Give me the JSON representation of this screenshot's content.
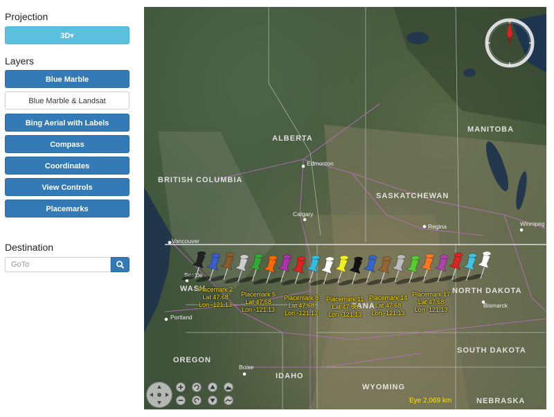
{
  "sidebar": {
    "projection_heading": "Projection",
    "projection_button": "3D▾",
    "layers_heading": "Layers",
    "layers": [
      {
        "label": "Blue Marble",
        "active": true
      },
      {
        "label": "Blue Marble & Landsat",
        "active": false
      },
      {
        "label": "Bing Aerial with Labels",
        "active": true
      },
      {
        "label": "Compass",
        "active": true
      },
      {
        "label": "Coordinates",
        "active": true
      },
      {
        "label": "View Controls",
        "active": true
      },
      {
        "label": "Placemarks",
        "active": true
      }
    ],
    "destination_heading": "Destination",
    "goto_placeholder": "GoTo"
  },
  "map": {
    "region_labels": [
      "ALBERTA",
      "BRITISH COLUMBIA",
      "SASKATCHEWAN",
      "MANITOBA",
      "NORTH DAKOTA",
      "SOUTH DAKOTA",
      "OREGON",
      "IDAHO",
      "WYOMING",
      "NEBRASKA",
      "WASH",
      "TANA"
    ],
    "city_labels": [
      "Edmonton",
      "Calgary",
      "Regina",
      "Winnipeg",
      "Vancouver",
      "Seattle",
      "Portland",
      "Boise",
      "Bismarck"
    ],
    "placemarks": [
      {
        "name": "Placemark 2",
        "lat": "Lat 47.68",
        "lon": "Lon -121.13"
      },
      {
        "name": "Placemark 5",
        "lat": "Lat 47.68",
        "lon": "Lon -121.13"
      },
      {
        "name": "Placemark 8",
        "lat": "Lat 47.68",
        "lon": "Lon -121.13"
      },
      {
        "name": "Placemark 11",
        "lat": "Lat 47.68",
        "lon": "Lon -121.13"
      },
      {
        "name": "Placemark 14",
        "lat": "Lat 47.68",
        "lon": "Lon -121.13"
      },
      {
        "name": "Placemark 17",
        "lat": "Lat 47.68",
        "lon": "Lon -121.13"
      }
    ],
    "pin_colors": [
      "#222222",
      "#3a5fcd",
      "#8b5a2b",
      "#cccccc",
      "#33aa33",
      "#ff6a00",
      "#aa33aa",
      "#dd2222",
      "#33bbdd",
      "#ffffff",
      "#eeee22",
      "#111111",
      "#3366cc",
      "#996633",
      "#bbbbbb",
      "#55cc33",
      "#ff7722",
      "#aa44aa",
      "#dd2222",
      "#44c0e0",
      "#ffffff"
    ],
    "eye_readout": "Eye  2,069 km"
  }
}
